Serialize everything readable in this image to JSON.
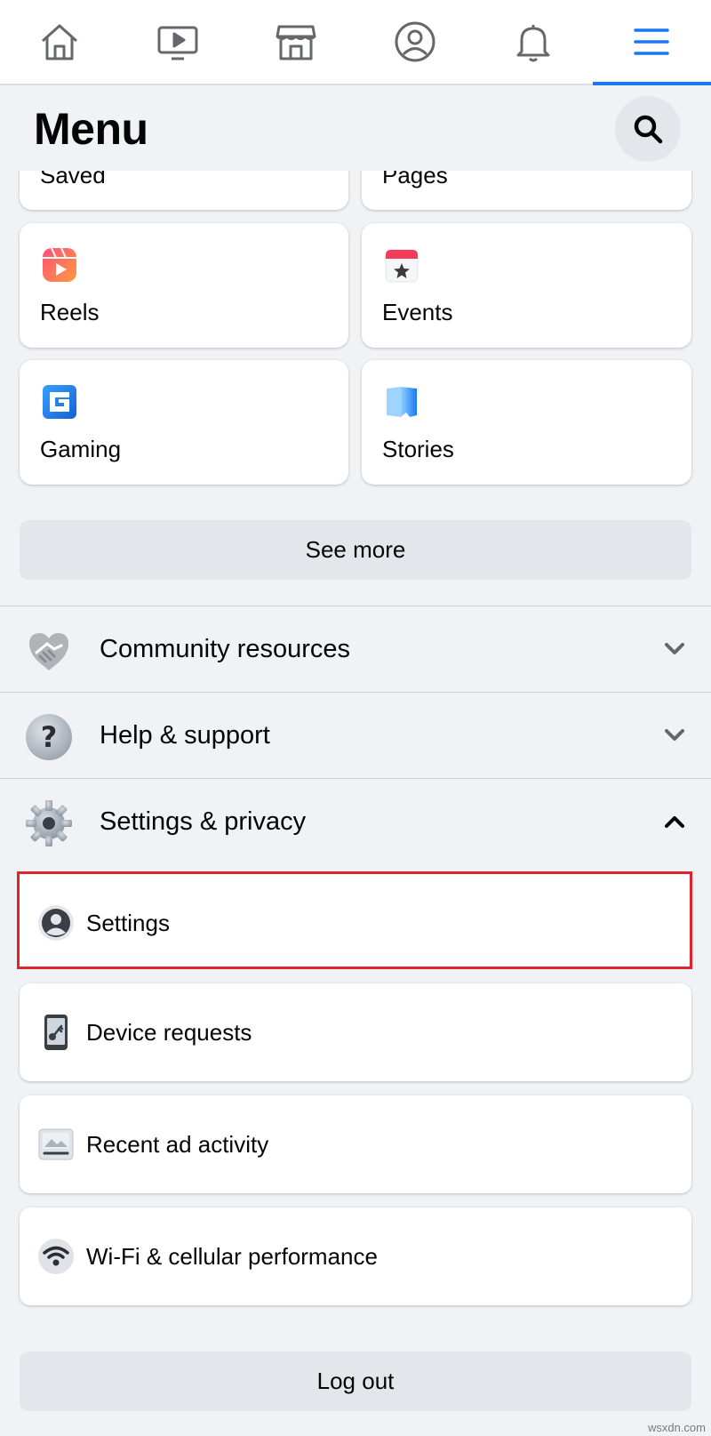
{
  "nav": {
    "tabs": [
      {
        "name": "home-icon"
      },
      {
        "name": "video-icon"
      },
      {
        "name": "marketplace-icon"
      },
      {
        "name": "profile-icon"
      },
      {
        "name": "notifications-icon"
      },
      {
        "name": "menu-icon",
        "active": true
      }
    ],
    "accent": "#1877f2"
  },
  "header": {
    "title": "Menu",
    "search_icon": "search-icon"
  },
  "shortcuts": {
    "partial": [
      {
        "label": "Saved"
      },
      {
        "label": "Pages"
      }
    ],
    "items": [
      {
        "label": "Reels",
        "icon": "reels-icon"
      },
      {
        "label": "Events",
        "icon": "events-icon"
      },
      {
        "label": "Gaming",
        "icon": "gaming-icon"
      },
      {
        "label": "Stories",
        "icon": "stories-icon"
      }
    ],
    "see_more": "See more"
  },
  "sections": [
    {
      "label": "Community resources",
      "icon": "handshake-icon",
      "expanded": false
    },
    {
      "label": "Help & support",
      "icon": "question-icon",
      "expanded": false
    },
    {
      "label": "Settings & privacy",
      "icon": "gear-icon",
      "expanded": true
    }
  ],
  "settings_items": [
    {
      "label": "Settings",
      "icon": "user-circle-icon",
      "highlighted": true,
      "highlight_color": "#e0242c"
    },
    {
      "label": "Device requests",
      "icon": "phone-key-icon"
    },
    {
      "label": "Recent ad activity",
      "icon": "ad-activity-icon"
    },
    {
      "label": "Wi-Fi & cellular performance",
      "icon": "wifi-icon"
    }
  ],
  "logout": "Log out",
  "watermark": "wsxdn.com"
}
